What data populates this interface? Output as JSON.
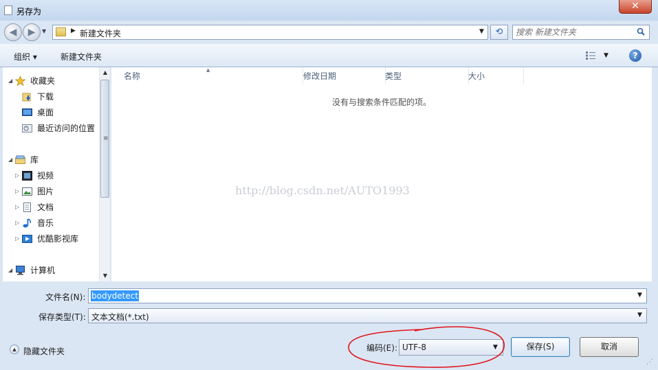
{
  "window": {
    "title": "另存为",
    "close_label": "✕"
  },
  "address": {
    "path": "新建文件夹",
    "refresh_icon": "refresh-icon",
    "search_placeholder": "搜索 新建文件夹"
  },
  "toolbar": {
    "organize": "组织 ▾",
    "new_folder": "新建文件夹"
  },
  "nav_tree": [
    {
      "label": "收藏夹",
      "level": 0,
      "expander": "◢",
      "icon": "star-icon"
    },
    {
      "label": "下载",
      "level": 1,
      "expander": "",
      "icon": "downloads-icon"
    },
    {
      "label": "桌面",
      "level": 1,
      "expander": "",
      "icon": "desktop-icon"
    },
    {
      "label": "最近访问的位置",
      "level": 1,
      "expander": "",
      "icon": "recent-places-icon"
    },
    {
      "label": "库",
      "level": 0,
      "expander": "◢",
      "icon": "libraries-icon"
    },
    {
      "label": "视频",
      "level": 1,
      "expander": "▷",
      "icon": "video-icon"
    },
    {
      "label": "图片",
      "level": 1,
      "expander": "▷",
      "icon": "pictures-icon"
    },
    {
      "label": "文档",
      "level": 1,
      "expander": "▷",
      "icon": "documents-icon"
    },
    {
      "label": "音乐",
      "level": 1,
      "expander": "▷",
      "icon": "music-icon"
    },
    {
      "label": "优酷影视库",
      "level": 1,
      "expander": "▷",
      "icon": "youku-library-icon"
    },
    {
      "label": "计算机",
      "level": 0,
      "expander": "◢",
      "icon": "computer-icon"
    }
  ],
  "columns": [
    {
      "label": "名称"
    },
    {
      "label": "修改日期"
    },
    {
      "label": "类型"
    },
    {
      "label": "大小"
    }
  ],
  "file_list": {
    "empty_message": "没有与搜索条件匹配的项。",
    "watermark": "http://blog.csdn.net/AUTO1993"
  },
  "form": {
    "filename_label": "文件名(N):",
    "filename_value": "bodydetect",
    "filetype_label": "保存类型(T):",
    "filetype_value": "文本文档(*.txt)",
    "encoding_label": "编码(E):",
    "encoding_value": "UTF-8"
  },
  "footer": {
    "hide_folders": "隐藏文件夹",
    "save": "保存(S)",
    "cancel": "取消"
  },
  "colors": {
    "annotation": "#e0141a",
    "selection": "#3399ff",
    "window_frame": "#dbe6f4"
  }
}
